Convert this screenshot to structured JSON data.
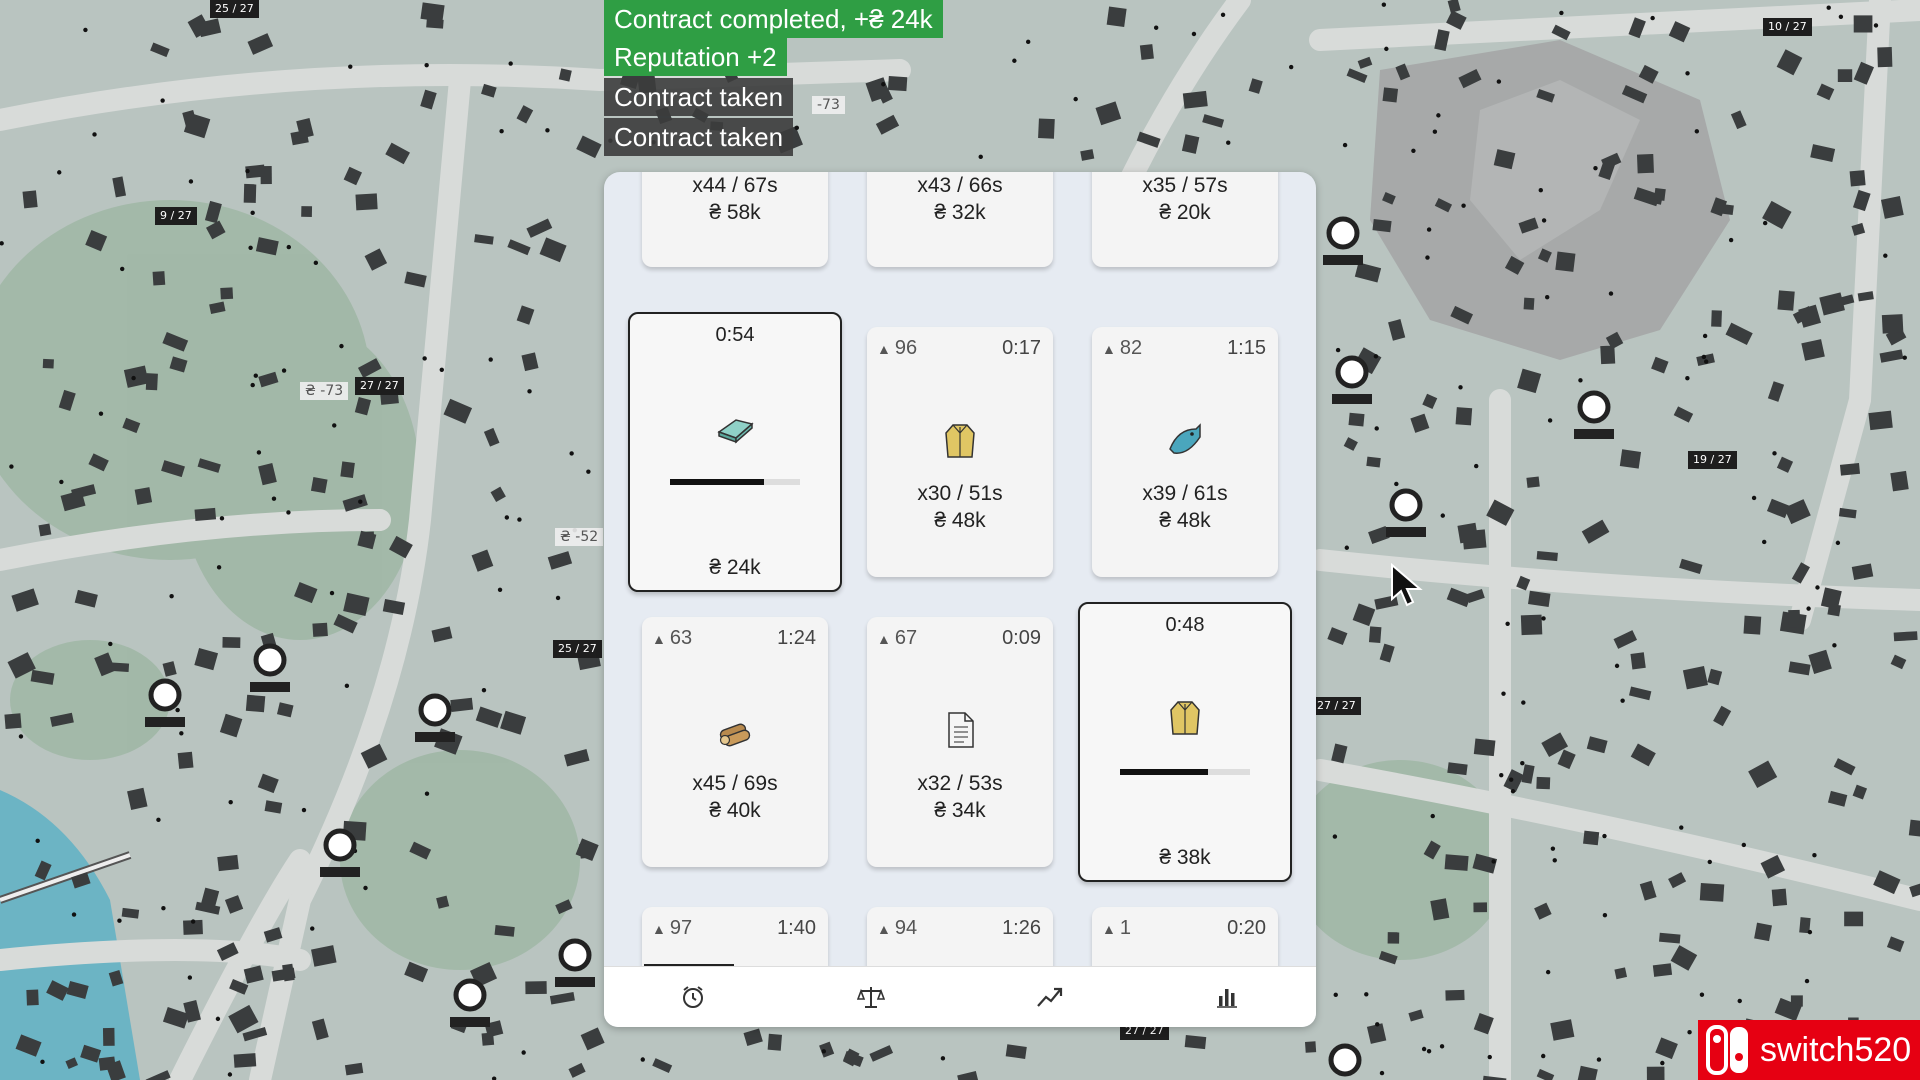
{
  "notifications": [
    {
      "text": "Contract completed, +₴ 24k",
      "style": "green"
    },
    {
      "text": "Reputation +2",
      "style": "green"
    },
    {
      "text": "Contract taken",
      "style": "dark"
    },
    {
      "text": "Contract taken",
      "style": "dark"
    }
  ],
  "map_labels": {
    "l1": "25 / 27",
    "l2": "9 / 27",
    "l3": "27 / 27",
    "l4": "₴ -73",
    "l5": "25 / 27",
    "l6": "₴ -52",
    "l7": "10 / 27",
    "l8": "19 / 27",
    "l9": "27 / 27",
    "l10": "27 / 27",
    "l11": "-73",
    "l12": "26 / 27"
  },
  "contracts": {
    "row0": [
      {
        "qty": "x44 / 67s",
        "price": "₴ 58k"
      },
      {
        "qty": "x43 / 66s",
        "price": "₴ 32k"
      },
      {
        "qty": "x35 / 57s",
        "price": "₴ 20k"
      }
    ],
    "row1": [
      {
        "time": "0:54",
        "icon": "steel-ingot-icon",
        "price": "₴ 24k",
        "progress": 0.72
      },
      {
        "rep": "96",
        "time": "0:17",
        "icon": "coat-icon",
        "qty": "x30 / 51s",
        "price": "₴ 48k"
      },
      {
        "rep": "82",
        "time": "1:15",
        "icon": "fish-icon",
        "qty": "x39 / 61s",
        "price": "₴ 48k"
      }
    ],
    "row2": [
      {
        "rep": "63",
        "time": "1:24",
        "icon": "logs-icon",
        "qty": "x45 / 69s",
        "price": "₴ 40k"
      },
      {
        "rep": "67",
        "time": "0:09",
        "icon": "document-icon",
        "qty": "x32 / 53s",
        "price": "₴ 34k"
      },
      {
        "time": "0:48",
        "icon": "coat-icon",
        "price": "₴ 38k",
        "progress": 0.68
      }
    ],
    "row3": [
      {
        "rep": "97",
        "time": "1:40"
      },
      {
        "rep": "94",
        "time": "1:26"
      },
      {
        "rep": "1",
        "time": "0:20"
      }
    ]
  },
  "tabs": [
    "alarm-clock-icon",
    "scales-icon",
    "trend-up-icon",
    "bar-chart-icon"
  ],
  "brand": {
    "text": "switch520",
    "color": "#e60012"
  },
  "colors": {
    "notif_green": "#2f9e44",
    "panel_bg": "#e6ebf2",
    "water": "#6cb4c4"
  }
}
